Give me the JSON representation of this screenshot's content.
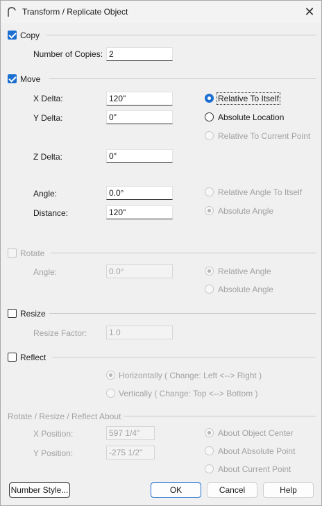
{
  "window": {
    "title": "Transform / Replicate Object"
  },
  "copy": {
    "label": "Copy",
    "checked": true,
    "number_label": "Number of Copies:",
    "number_value": "2"
  },
  "move": {
    "label": "Move",
    "checked": true,
    "x_label": "X Delta:",
    "x_value": "120\"",
    "y_label": "Y Delta:",
    "y_value": "0\"",
    "z_label": "Z Delta:",
    "z_value": "0\"",
    "angle_label": "Angle:",
    "angle_value": "0.0°",
    "distance_label": "Distance:",
    "distance_value": "120\"",
    "relative_itself": "Relative To Itself",
    "absolute_location": "Absolute Location",
    "relative_current": "Relative To Current Point",
    "relative_angle_itself": "Relative Angle To Itself",
    "absolute_angle": "Absolute Angle"
  },
  "rotate": {
    "label": "Rotate",
    "checked": false,
    "angle_label": "Angle:",
    "angle_value": "0.0°",
    "relative_angle": "Relative Angle",
    "absolute_angle": "Absolute Angle"
  },
  "resize": {
    "label": "Resize",
    "checked": false,
    "factor_label": "Resize Factor:",
    "factor_value": "1.0"
  },
  "reflect": {
    "label": "Reflect",
    "checked": false,
    "horizontal": "Horizontally ( Change: Left <--> Right )",
    "vertical": "Vertically ( Change: Top <--> Bottom )"
  },
  "about": {
    "label": "Rotate / Resize / Reflect About",
    "x_label": "X Position:",
    "x_value": "597 1/4\"",
    "y_label": "Y Position:",
    "y_value": "-275 1/2\"",
    "object_center": "About Object Center",
    "absolute_point": "About Absolute Point",
    "current_point": "About Current Point"
  },
  "buttons": {
    "number_style": "Number Style...",
    "ok": "OK",
    "cancel": "Cancel",
    "help": "Help"
  },
  "colors": {
    "accent": "#1c6fd0",
    "background": "#f0f0f0",
    "disabled_text": "#a2a2a2"
  }
}
